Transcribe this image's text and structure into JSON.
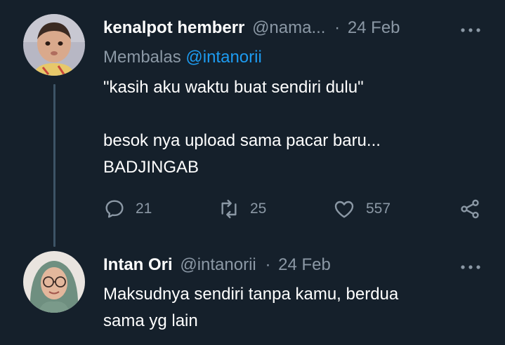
{
  "tweets": [
    {
      "display_name": "kenalpot hemberr",
      "handle": "@nama...",
      "separator": "·",
      "date": "24 Feb",
      "reply_prefix": "Membalas",
      "reply_to": "@intanorii",
      "text": "\"kasih aku waktu buat sendiri dulu\"\n\nbesok nya upload sama pacar baru...\nBADJINGAB",
      "replies": "21",
      "retweets": "25",
      "likes": "557",
      "avatar_icon": "baby-avatar"
    },
    {
      "display_name": "Intan Ori",
      "handle": "@intanorii",
      "separator": "·",
      "date": "24 Feb",
      "text": "Maksudnya sendiri tanpa kamu, berdua\nsama yg lain",
      "avatar_icon": "hijab-woman-avatar"
    }
  ],
  "icons": {
    "more": "more-horizontal-icon",
    "reply": "reply-icon",
    "retweet": "retweet-icon",
    "like": "heart-icon",
    "share": "share-icon"
  },
  "colors": {
    "background": "#15202b",
    "text": "#ffffff",
    "muted": "#8b98a5",
    "link": "#1d9bf0",
    "thread_line": "#3d5466"
  }
}
